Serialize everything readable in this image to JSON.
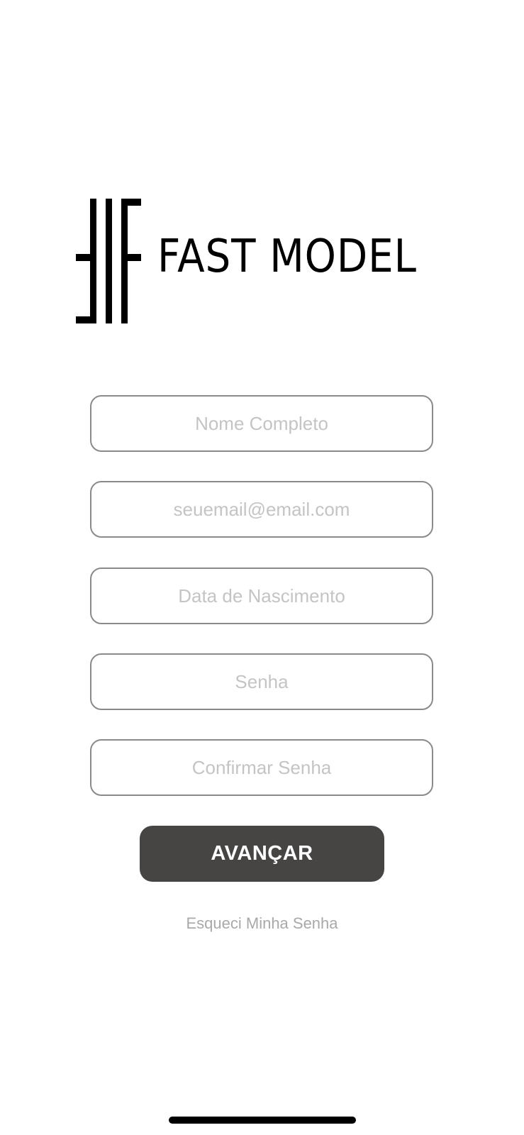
{
  "brand": {
    "name": "FAST MODEL"
  },
  "form": {
    "full_name": {
      "placeholder": "Nome Completo"
    },
    "email": {
      "placeholder": "seuemail@email.com"
    },
    "birth_date": {
      "placeholder": "Data de Nascimento"
    },
    "password": {
      "placeholder": "Senha"
    },
    "confirm_password": {
      "placeholder": "Confirmar Senha"
    }
  },
  "actions": {
    "submit_label": "AVANÇAR",
    "forgot_password_label": "Esqueci Minha Senha"
  },
  "colors": {
    "button_bg": "#464544",
    "field_border": "#8a8a8a",
    "placeholder": "#c4c4c4",
    "link": "#a9a9a9"
  }
}
